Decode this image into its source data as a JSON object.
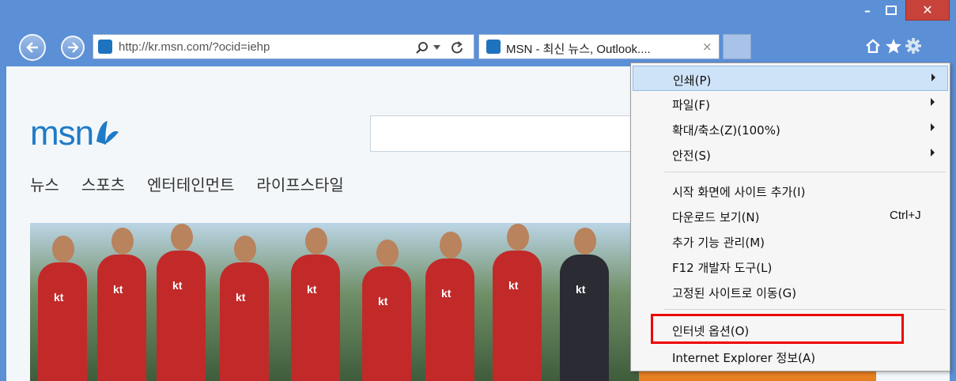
{
  "browser": {
    "address_url": "http://kr.msn.com/?ocid=iehp",
    "tab_title": "MSN - 최신 뉴스, Outlook....",
    "tab_close": "×",
    "window_buttons": {
      "minimize": "–",
      "close": "✕"
    },
    "icons": [
      "back-arrow-icon",
      "forward-arrow-icon",
      "favicon-msn-icon",
      "search-icon",
      "dropdown-icon",
      "refresh-icon",
      "home-icon",
      "favorites-star-icon",
      "tools-gear-icon"
    ]
  },
  "page": {
    "logo_text": "msn",
    "nav_links": [
      "뉴스",
      "스포츠",
      "엔터테인먼트",
      "라이프스타일"
    ],
    "photo_jersey_text": "kt"
  },
  "tools_menu": {
    "items": [
      {
        "label": "인쇄(P)",
        "submenu": true,
        "highlighted": true
      },
      {
        "label": "파일(F)",
        "submenu": true
      },
      {
        "label": "확대/축소(Z)(100%)",
        "submenu": true
      },
      {
        "label": "안전(S)",
        "submenu": true
      },
      {
        "label": "시작 화면에 사이트 추가(I)"
      },
      {
        "label": "다운로드 보기(N)",
        "shortcut": "Ctrl+J"
      },
      {
        "label": "추가 기능 관리(M)"
      },
      {
        "label": "F12 개발자 도구(L)"
      },
      {
        "label": "고정된 사이트로 이동(G)"
      },
      {
        "label": "인터넷 옵션(O)",
        "outlined": true
      },
      {
        "label": "Internet Explorer 정보(A)"
      }
    ]
  },
  "colors": {
    "frame": "#5b8fd6",
    "highlight": "#cfe3f8",
    "outline": "#ee0000",
    "logo": "#1f7bc7"
  }
}
